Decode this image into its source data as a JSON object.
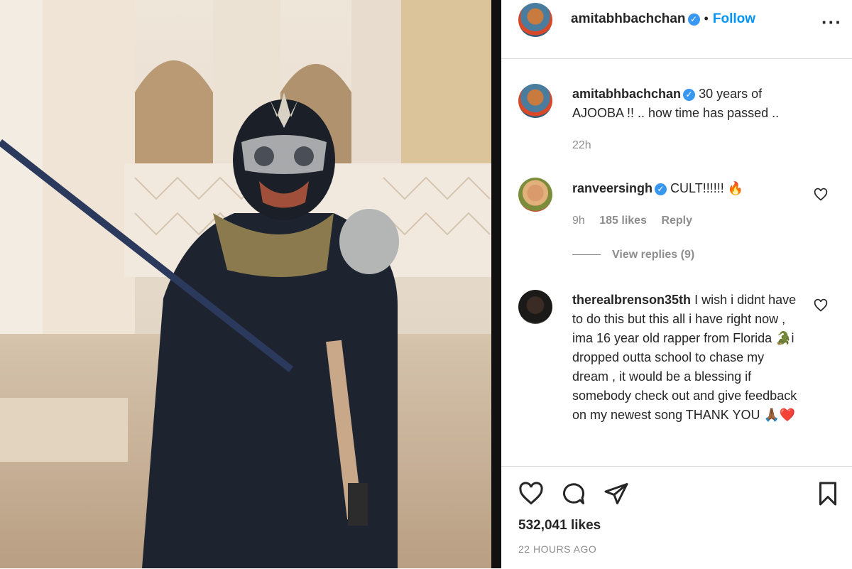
{
  "post": {
    "author": "amitabhbachchan",
    "follow_label": "Follow",
    "caption": "30 years of AJOOBA !! .. how time has passed ..",
    "caption_time": "22h",
    "likes": "532,041 likes",
    "timestamp": "22 HOURS AGO"
  },
  "comments": [
    {
      "user": "ranveersingh",
      "text": "CULT!!!!!! 🔥",
      "time": "9h",
      "likes": "185 likes",
      "reply_label": "Reply",
      "view_replies": "View replies (9)"
    },
    {
      "user": "therealbrenson35th",
      "text": "I wish i didnt have to do this but this all i have right now , ima 16 year old rapper from Florida 🐊i dropped outta school to chase my dream , it would be a blessing if somebody check out and give feedback on my newest song THANK YOU 🙏🏾❤️"
    }
  ],
  "icons": {
    "verified": "verified-badge-icon",
    "more": "more-options-icon",
    "like": "heart-icon",
    "comment": "comment-bubble-icon",
    "share": "paper-plane-icon",
    "save": "bookmark-icon"
  },
  "colors": {
    "accent": "#0095f6",
    "verified": "#3897f0",
    "muted": "#8e8e8e",
    "border": "#dbdbdb"
  }
}
